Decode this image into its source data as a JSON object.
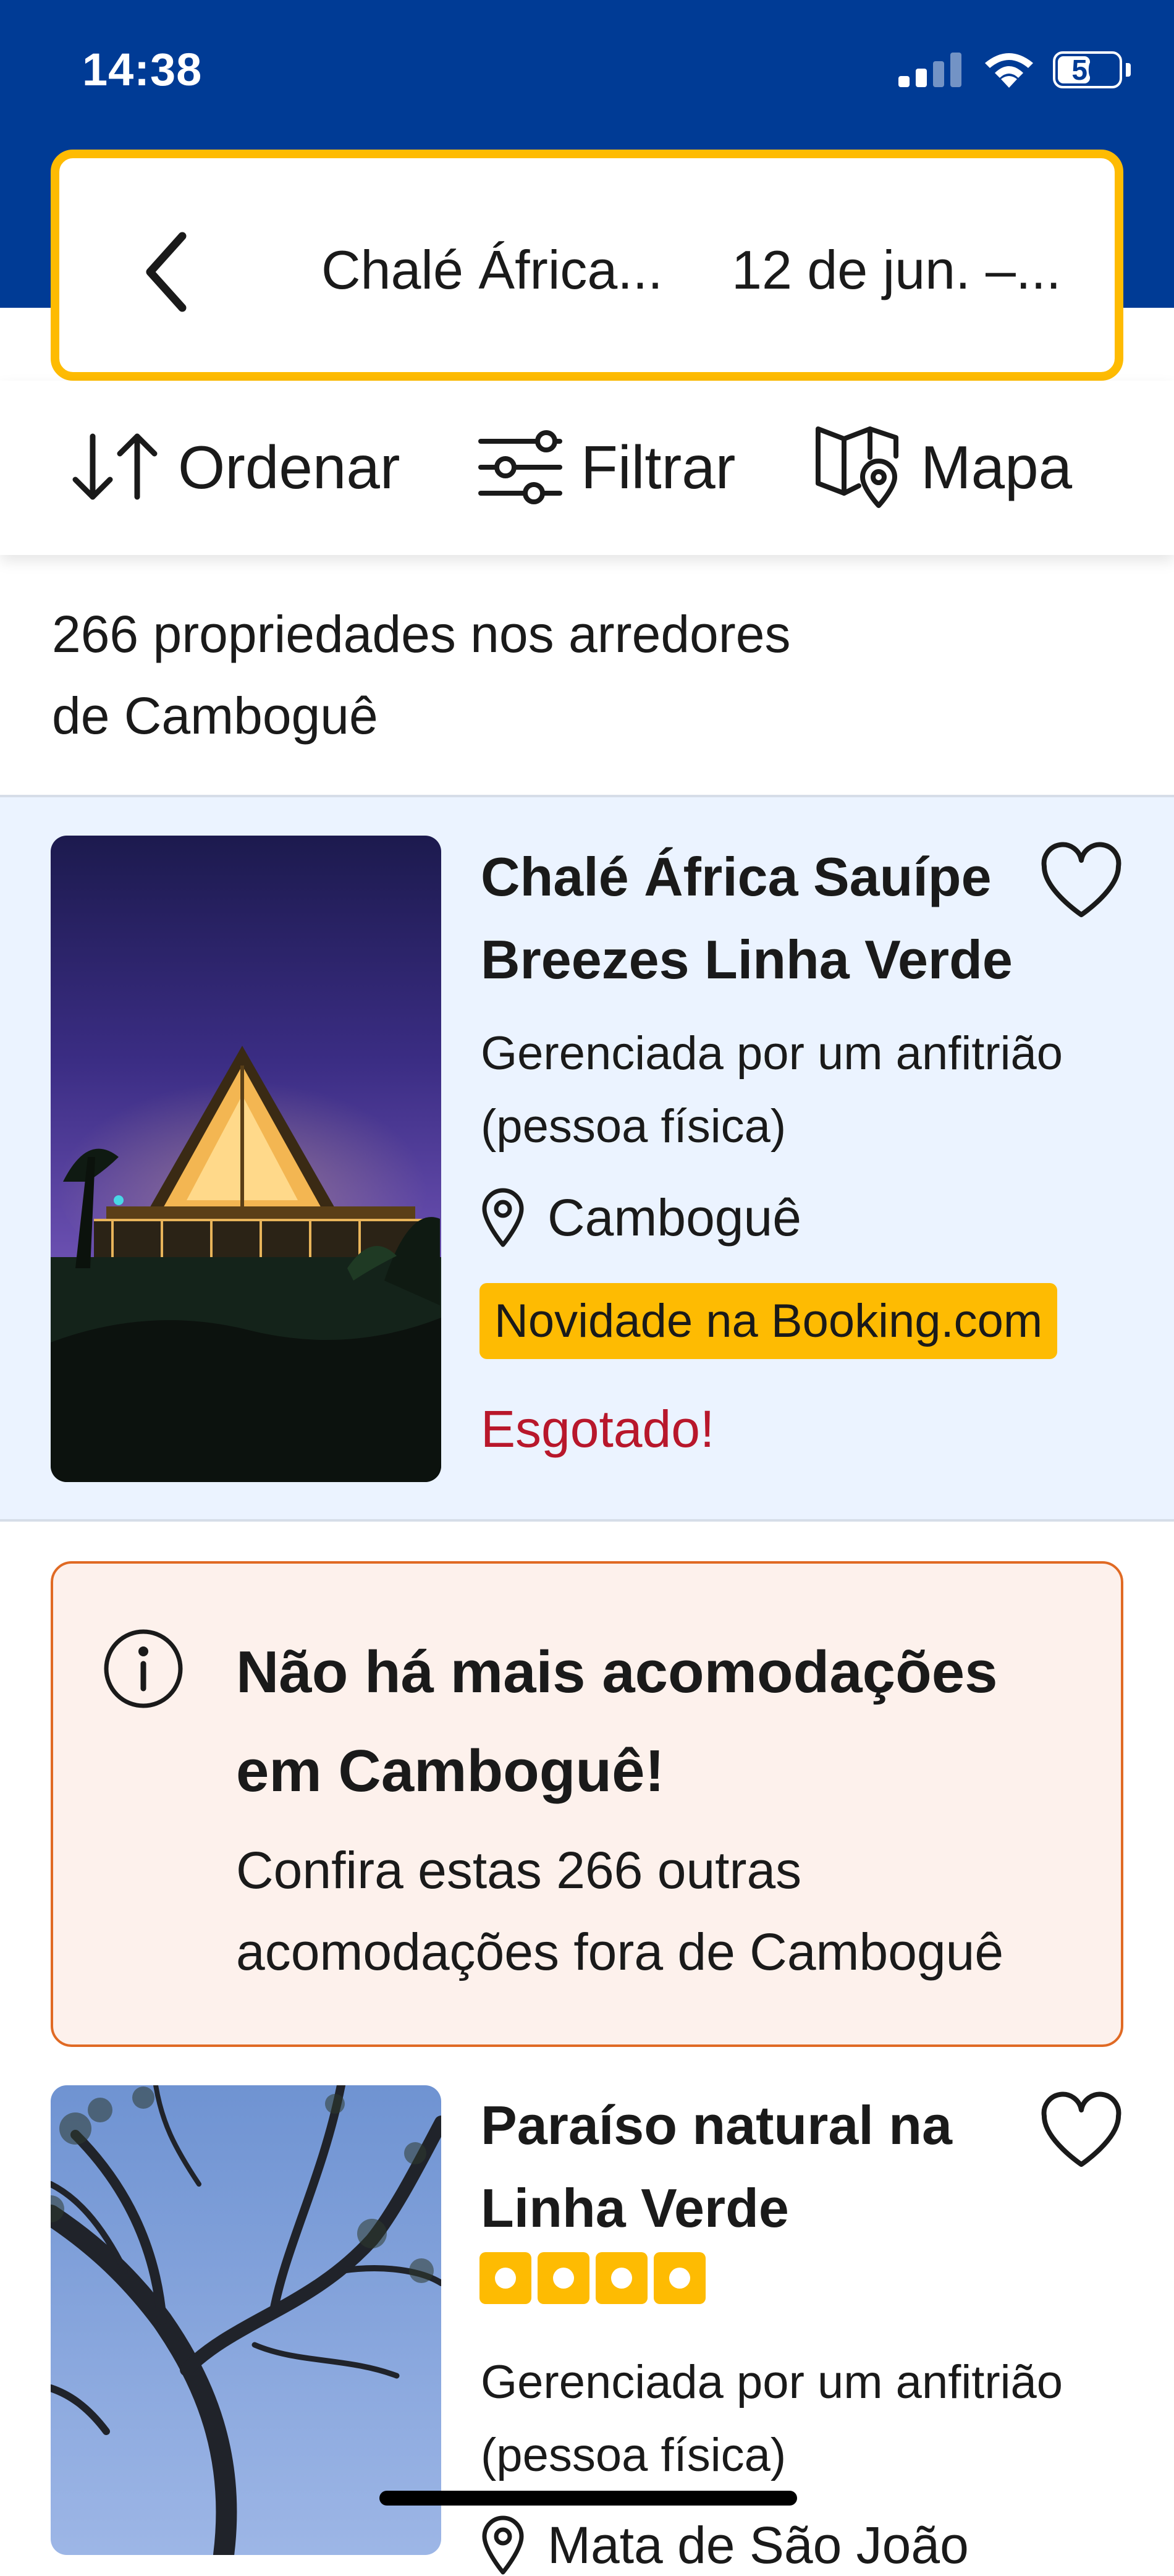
{
  "status_bar": {
    "time": "14:38",
    "battery": "50",
    "battery_level": 0.5
  },
  "search": {
    "destination": "Chalé África...",
    "dates": "12 de jun. –..."
  },
  "toolbar": {
    "sort_label": "Ordenar",
    "filter_label": "Filtrar",
    "map_label": "Mapa"
  },
  "results": {
    "count_line1": "266 propriedades nos arredores",
    "count_line2": "de Camboguê"
  },
  "property1": {
    "title_line1": "Chalé África Sauípe",
    "title_line2": "Breezes Linha Verde",
    "host_line1": "Gerenciada por um anfitrião",
    "host_line2": "(pessoa física)",
    "location": "Camboguê",
    "badge": "Novidade na Booking.com",
    "availability": "Esgotado!"
  },
  "notice": {
    "title_line1": "Não há mais acomodações",
    "title_line2": "em Camboguê!",
    "body_line1": "Confira estas 266 outras",
    "body_line2": "acomodações fora de Camboguê"
  },
  "property2": {
    "title_line1": "Paraíso natural na",
    "title_line2": "Linha Verde",
    "rating_squares": 4,
    "host_line1": "Gerenciada por um anfitrião",
    "host_line2": "(pessoa física)",
    "location_partial": "Mata de São João"
  },
  "colors": {
    "brand_blue": "#003b95",
    "accent_yellow": "#febb02",
    "sold_out_red": "#b8172b",
    "notice_border": "#e06a24"
  },
  "icons": [
    "back-chevron-icon",
    "sort-icon",
    "filter-icon",
    "map-icon",
    "heart-icon",
    "location-pin-icon",
    "info-icon",
    "signal-icon",
    "wifi-icon",
    "battery-icon"
  ]
}
